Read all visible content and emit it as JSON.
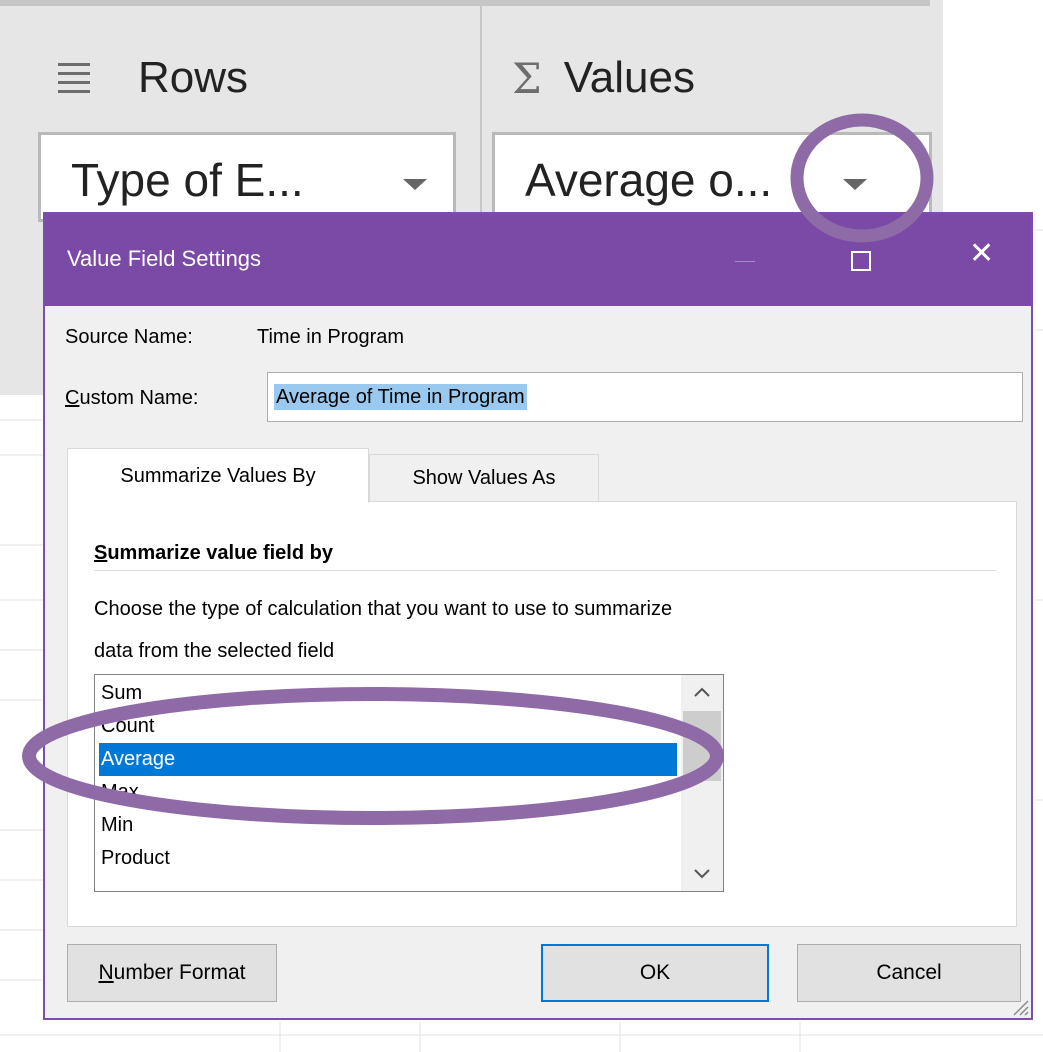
{
  "pivot": {
    "rows_label": "Rows",
    "values_label": "Values",
    "sigma_symbol": "Σ",
    "rows_field": "Type of E...",
    "values_field": "Average o..."
  },
  "dialog": {
    "title": "Value Field Settings",
    "maximize_symbol": "",
    "close_symbol": "✕",
    "source_name_label": "Source Name:",
    "source_name_value": "Time in Program",
    "custom_name_label_prefix": "C",
    "custom_name_label_rest": "ustom Name:",
    "custom_name_value": "Average of Time in Program",
    "tabs": [
      {
        "label": "Summarize Values By"
      },
      {
        "label": "Show Values As"
      }
    ],
    "section_title_prefix": "S",
    "section_title_rest": "ummarize value field by",
    "description_line1": "Choose the type of calculation that you want to use to summarize",
    "description_line2": "data from the selected field",
    "calculations": [
      {
        "label": "Sum"
      },
      {
        "label": "Count"
      },
      {
        "label": "Average"
      },
      {
        "label": "Max"
      },
      {
        "label": "Min"
      },
      {
        "label": "Product"
      }
    ],
    "selected_calculation": "Average",
    "scroll_up_symbol": "︿",
    "scroll_down_symbol": "﹀",
    "buttons": {
      "number_format_prefix": "N",
      "number_format_rest": "umber Format",
      "ok": "OK",
      "cancel": "Cancel"
    }
  },
  "colors": {
    "titlebar": "#7a4aa6",
    "annotation": "#8e6aa6",
    "selection": "#0078d7"
  }
}
